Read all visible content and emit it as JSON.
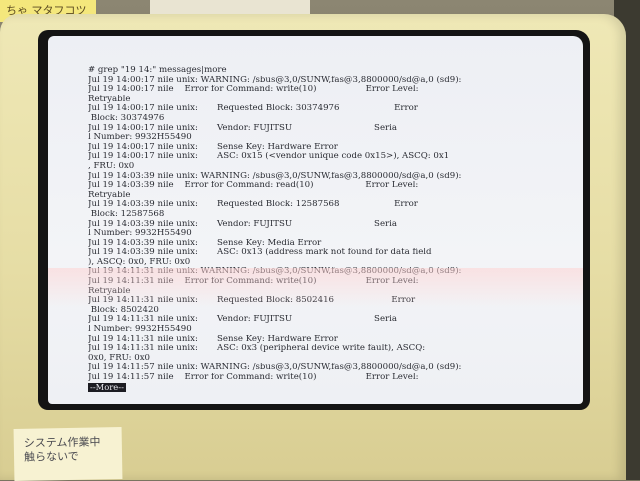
{
  "environment": {
    "sticky_note_top": "ちゃ マタフコツー",
    "sticky_note_bottom": [
      "システム作業中",
      "触らないで"
    ]
  },
  "terminal": {
    "lines": [
      "# grep \"19 14:\" messages|more",
      "Jul 19 14:00:17 nile unix: WARNING: /sbus@3,0/SUNW,fas@3,8800000/sd@a,0 (sd9):",
      "Jul 19 14:00:17 nile    Error for Command: write(10)                  Error Level:",
      "Retryable",
      "Jul 19 14:00:17 nile unix:       Requested Block: 30374976                    Error",
      " Block: 30374976",
      "Jul 19 14:00:17 nile unix:       Vendor: FUJITSU                              Seria",
      "l Number: 9932H55490",
      "Jul 19 14:00:17 nile unix:       Sense Key: Hardware Error",
      "Jul 19 14:00:17 nile unix:       ASC: 0x15 (<vendor unique code 0x15>), ASCQ: 0x1",
      ", FRU: 0x0",
      "Jul 19 14:03:39 nile unix: WARNING: /sbus@3,0/SUNW,fas@3,8800000/sd@a,0 (sd9):",
      "Jul 19 14:03:39 nile    Error for Command: read(10)                   Error Level:",
      "Retryable",
      "Jul 19 14:03:39 nile unix:       Requested Block: 12587568                    Error",
      " Block: 12587568",
      "Jul 19 14:03:39 nile unix:       Vendor: FUJITSU                              Seria",
      "l Number: 9932H55490",
      "Jul 19 14:03:39 nile unix:       Sense Key: Media Error",
      "Jul 19 14:03:39 nile unix:       ASC: 0x13 (address mark not found for data field",
      "), ASCQ: 0x0, FRU: 0x0",
      "Jul 19 14:11:31 nile unix: WARNING: /sbus@3,0/SUNW,fas@3,8800000/sd@a,0 (sd9):",
      "Jul 19 14:11:31 nile    Error for Command: write(10)                  Error Level:",
      "Retryable",
      "Jul 19 14:11:31 nile unix:       Requested Block: 8502416                     Error",
      " Block: 8502420",
      "Jul 19 14:11:31 nile unix:       Vendor: FUJITSU                              Seria",
      "l Number: 9932H55490",
      "Jul 19 14:11:31 nile unix:       Sense Key: Hardware Error",
      "Jul 19 14:11:31 nile unix:       ASC: 0x3 (peripheral device write fault), ASCQ:",
      "0x0, FRU: 0x0",
      "Jul 19 14:11:57 nile unix: WARNING: /sbus@3,0/SUNW,fas@3,8800000/sd@a,0 (sd9):",
      "Jul 19 14:11:57 nile    Error for Command: write(10)                  Error Level:"
    ],
    "pager_prompt": "--More--"
  }
}
